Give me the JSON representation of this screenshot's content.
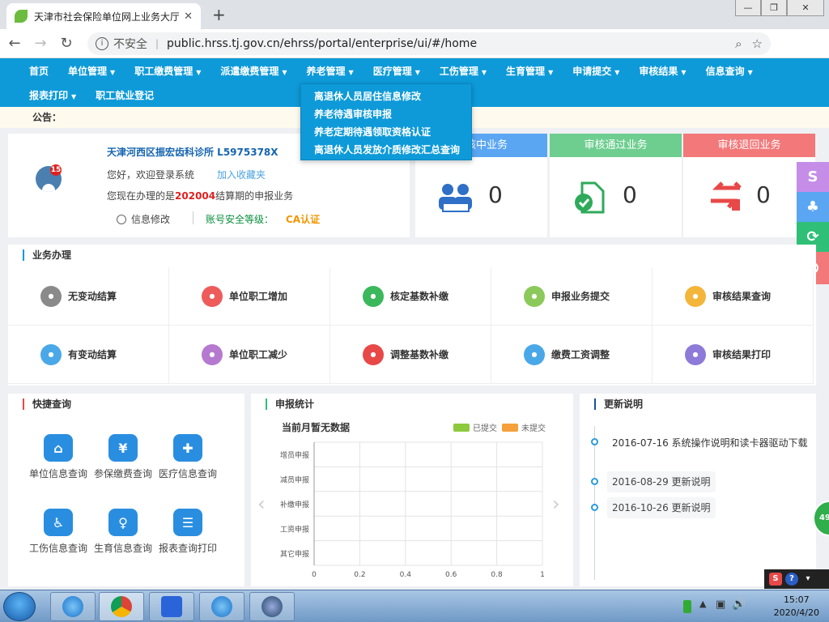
{
  "browser": {
    "tab_title": "天津市社会保险单位网上业务大厅",
    "security": "不安全",
    "url": "public.hrss.tj.gov.cn/ehrss/portal/enterprise/ui/#/home"
  },
  "nav": {
    "row1": [
      "首页",
      "单位管理",
      "职工缴费管理",
      "派遣缴费管理",
      "养老管理",
      "医疗管理",
      "工伤管理",
      "生育管理",
      "申请提交",
      "审核结果",
      "信息查询"
    ],
    "row1_caret": [
      false,
      true,
      true,
      true,
      true,
      true,
      true,
      true,
      true,
      true,
      true
    ],
    "row2": [
      "报表打印",
      "职工就业登记"
    ],
    "row2_caret": [
      true,
      false
    ],
    "accent": "#0e9ad8"
  },
  "dropdown": [
    "离退休人员居住信息修改",
    "养老待遇审核申报",
    "养老定期待遇领取资格认证",
    "离退休人员发放介质修改汇总查询"
  ],
  "notice": "公告：",
  "user": {
    "name": "天津河西区振宏齿科诊所 L5975378X",
    "badge": "15",
    "hello": "您好，欢迎登录系统",
    "favorite": "加入收藏夹",
    "period_prefix": "您现在办理的是",
    "period": "202004",
    "period_suffix": "结算期的申报业务",
    "modify": "信息修改",
    "security_level": "账号安全等级：",
    "ca": "CA认证"
  },
  "stats": [
    {
      "title": "审核中业务",
      "value": "0",
      "color": "#5aa6f3"
    },
    {
      "title": "审核通过业务",
      "value": "0",
      "color": "#6dce8f"
    },
    {
      "title": "审核退回业务",
      "value": "0",
      "color": "#f2787a"
    }
  ],
  "float_buttons": [
    {
      "icon": "s-logo-icon",
      "color": "#c58de8"
    },
    {
      "icon": "tree-icon",
      "color": "#5aa6f3"
    },
    {
      "icon": "refresh-icon",
      "color": "#2fbf77"
    },
    {
      "icon": "power-icon",
      "color": "#f2787a"
    }
  ],
  "business": {
    "title": "业务办理",
    "items": [
      {
        "label": "无变动结算",
        "icon": "user-icon",
        "color": "#8a8a8a"
      },
      {
        "label": "单位职工增加",
        "icon": "add-user-icon",
        "color": "#ee5b5b"
      },
      {
        "label": "核定基数补缴",
        "icon": "card-icon",
        "color": "#3bb85c"
      },
      {
        "label": "申报业务提交",
        "icon": "document-icon",
        "color": "#8cc95b"
      },
      {
        "label": "审核结果查询",
        "icon": "search-icon",
        "color": "#f4b63a"
      },
      {
        "label": "有变动结算",
        "icon": "hand-icon",
        "color": "#4aa8e8"
      },
      {
        "label": "单位职工减少",
        "icon": "remove-user-icon",
        "color": "#b57ad0"
      },
      {
        "label": "调整基数补缴",
        "icon": "gear-icon",
        "color": "#e84848"
      },
      {
        "label": "缴费工资调整",
        "icon": "money-icon",
        "color": "#4aa8e8"
      },
      {
        "label": "审核结果打印",
        "icon": "print-icon",
        "color": "#8e7ad8"
      }
    ]
  },
  "quick": {
    "title": "快捷查询",
    "items": [
      {
        "label": "单位信息查询",
        "icon": "building-icon"
      },
      {
        "label": "参保缴费查询",
        "icon": "yuan-search-icon"
      },
      {
        "label": "医疗信息查询",
        "icon": "medical-kit-icon"
      },
      {
        "label": "工伤信息查询",
        "icon": "wheelchair-icon"
      },
      {
        "label": "生育信息查询",
        "icon": "pregnant-icon"
      },
      {
        "label": "报表查询打印",
        "icon": "report-search-icon"
      }
    ],
    "color": "#2a8ee0"
  },
  "report_stats": {
    "title": "申报统计"
  },
  "chart_data": {
    "type": "bar",
    "title": "当前月暂无数据",
    "categories": [
      "增员申报",
      "减员申报",
      "补缴申报",
      "工资申报",
      "其它申报"
    ],
    "series": [
      {
        "name": "已提交",
        "values": [
          0,
          0,
          0,
          0,
          0
        ],
        "color": "#8cc93c"
      },
      {
        "name": "未提交",
        "values": [
          0,
          0,
          0,
          0,
          0
        ],
        "color": "#f5a03a"
      }
    ],
    "xlim": [
      0,
      1
    ],
    "xticks": [
      "0",
      "0.2",
      "0.4",
      "0.6",
      "0.8",
      "1"
    ],
    "legend": "top-right",
    "grid": true
  },
  "updates": {
    "title": "更新说明",
    "items": [
      "2016-07-16 系统操作说明和读卡器驱动下载",
      "2016-08-29 更新说明",
      "2016-10-26 更新说明"
    ]
  },
  "side_badge": "49",
  "taskbar": {
    "time": "15:07",
    "date": "2020/4/20"
  }
}
